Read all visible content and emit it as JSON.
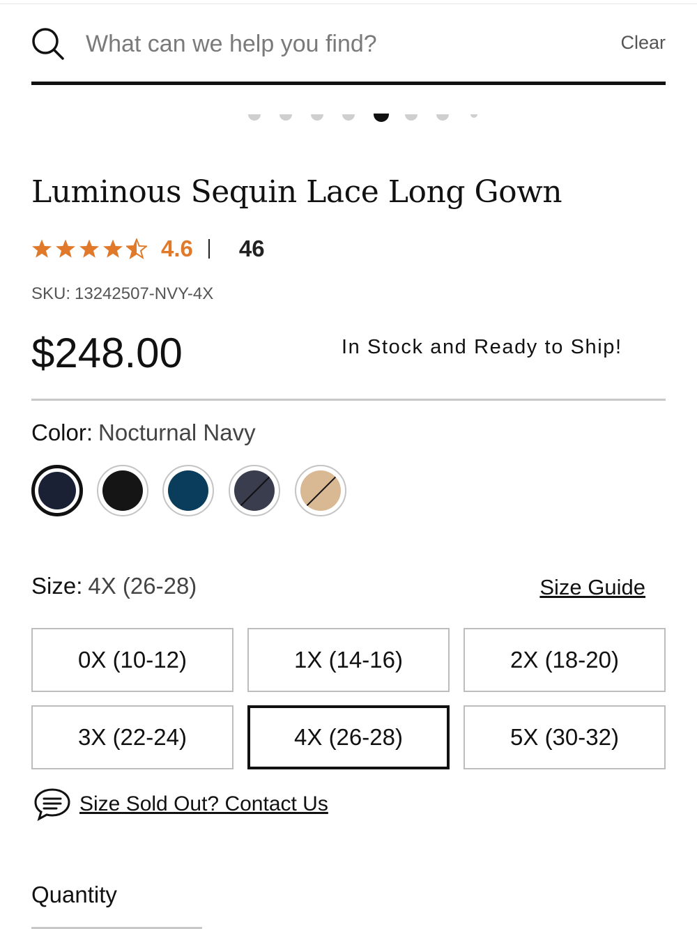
{
  "search": {
    "placeholder": "What can we help you find?",
    "clear_label": "Clear"
  },
  "carousel": {
    "total_dots": 8,
    "active_index": 4
  },
  "product": {
    "title": "Luminous Sequin Lace Long Gown",
    "rating": "4.6",
    "rating_stars": 4.5,
    "review_count": "46",
    "sku_label": "SKU:",
    "sku_value": "13242507-NVY-4X",
    "price": "$248.00",
    "stock_status": "In Stock and Ready to Ship!"
  },
  "color": {
    "label": "Color:",
    "selected": "Nocturnal Navy",
    "swatches": [
      {
        "color": "#1b2135",
        "selected": true,
        "unavailable": false
      },
      {
        "color": "#151515",
        "selected": false,
        "unavailable": false
      },
      {
        "color": "#0a3d5c",
        "selected": false,
        "unavailable": false
      },
      {
        "color": "#3a3d4e",
        "selected": false,
        "unavailable": true
      },
      {
        "color": "#d9b894",
        "selected": false,
        "unavailable": true
      }
    ]
  },
  "size": {
    "label": "Size:",
    "selected": "4X (26-28)",
    "guide_label": "Size Guide",
    "options": [
      "0X (10-12)",
      "1X (14-16)",
      "2X (18-20)",
      "3X (22-24)",
      "4X (26-28)",
      "5X (30-32)"
    ],
    "selected_index": 4
  },
  "sold_out": {
    "label": "Size Sold Out? Contact Us",
    "icon": "chat-bubble-icon"
  },
  "quantity": {
    "label": "Quantity"
  },
  "colors": {
    "accent_rating": "#e07a2a",
    "text": "#111111"
  }
}
